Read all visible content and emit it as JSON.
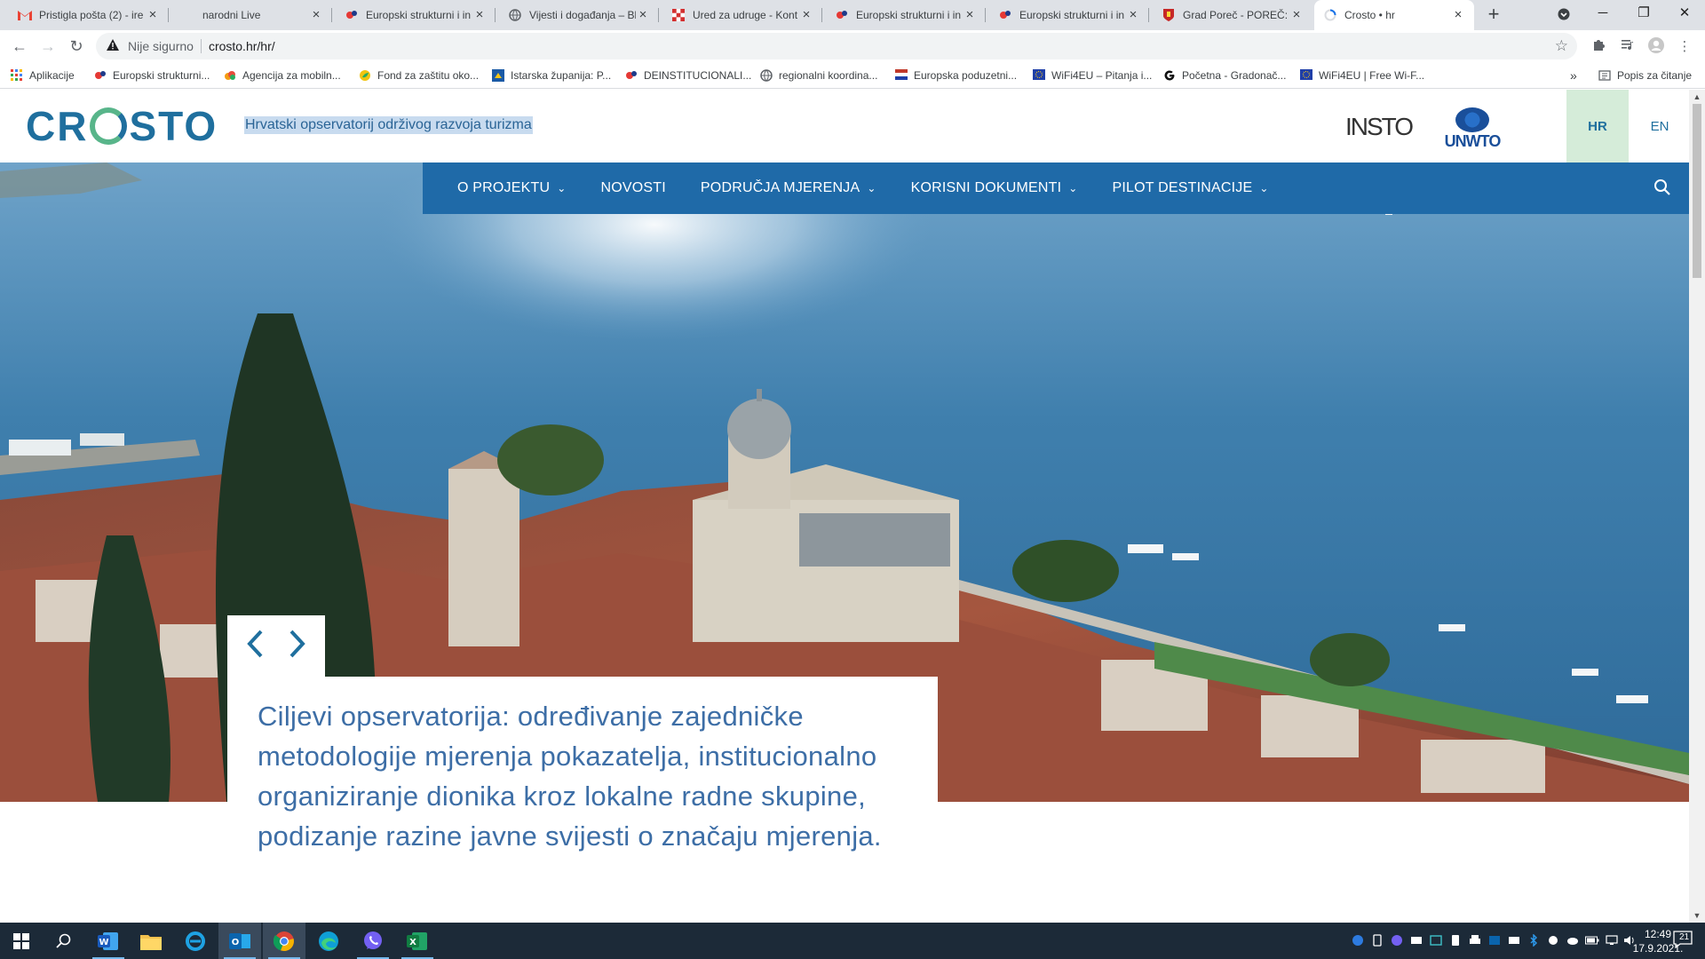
{
  "browser": {
    "tabs": [
      {
        "title": "Pristigla pošta (2) - ire",
        "icon": "gmail-icon"
      },
      {
        "title": "narodni Live",
        "icon": "none"
      },
      {
        "title": "Europski strukturni i in",
        "icon": "eu-funds-icon"
      },
      {
        "title": "Vijesti i događanja – Bl",
        "icon": "globe-icon"
      },
      {
        "title": "Ured za udruge - Kont",
        "icon": "croatia-checker-icon"
      },
      {
        "title": "Europski strukturni i in",
        "icon": "eu-funds-icon"
      },
      {
        "title": "Europski strukturni i in",
        "icon": "eu-funds-icon"
      },
      {
        "title": "Grad Poreč - POREČ: n",
        "icon": "porec-crest-icon"
      },
      {
        "title": "Crosto • hr",
        "icon": "loading-icon",
        "active": true
      }
    ],
    "security_label": "Nije sigurno",
    "url": "crosto.hr/hr/",
    "bookmarks": [
      {
        "label": "Aplikacije",
        "icon": "apps-grid-icon",
        "color": "#e94235"
      },
      {
        "label": "Europski strukturni...",
        "icon": "eu-funds-icon",
        "color": "#e53935"
      },
      {
        "label": "Agencija za mobiln...",
        "icon": "cloud-icon",
        "color": "#f39c12"
      },
      {
        "label": "Fond za zaštitu oko...",
        "icon": "leaf-icon",
        "color": "#f1c40f"
      },
      {
        "label": "Istarska županija: P...",
        "icon": "istria-icon",
        "color": "#1a5aa6"
      },
      {
        "label": "DEINSTITUCIONALI...",
        "icon": "eu-funds-icon",
        "color": "#e53935"
      },
      {
        "label": "regionalni koordina...",
        "icon": "globe-icon",
        "color": "#5f6368"
      },
      {
        "label": "Europska poduzetni...",
        "icon": "flag-icon",
        "color": "#c0392b"
      },
      {
        "label": "WiFi4EU – Pitanja i...",
        "icon": "eu-flag-icon",
        "color": "#1f3fa8"
      },
      {
        "label": "Početna - Gradonač...",
        "icon": "g-logo-icon",
        "color": "#111111"
      },
      {
        "label": "WiFi4EU | Free Wi-F...",
        "icon": "eu-flag-icon",
        "color": "#1f3fa8"
      }
    ],
    "reading_list": "Popis za čitanje"
  },
  "site": {
    "logo_text": "CROSTO",
    "tagline": "Hrvatski opservatorij održivog razvoja turizma",
    "partner1": "INSTO",
    "partner2": "UNWTO",
    "lang_hr": "HR",
    "lang_en": "EN",
    "nav": [
      {
        "label": "O PROJEKTU",
        "dropdown": true
      },
      {
        "label": "NOVOSTI",
        "dropdown": false
      },
      {
        "label": "PODRUČJA MJERENJA",
        "dropdown": true
      },
      {
        "label": "KORISNI DOKUMENTI",
        "dropdown": true
      },
      {
        "label": "PILOT DESTINACIJE",
        "dropdown": true
      }
    ],
    "slide_caption": "Ciljevi opservatorija: određivanje zajedničke metodologije mjerenja pokazatelja, institucionalno organiziranje dionika kroz lokalne radne skupine, podizanje razine javne svijesti o značaju mjerenja.",
    "colors": {
      "brand_blue": "#1f6aa8",
      "caption_blue": "#3d6ea6",
      "lang_active_bg": "#d5ecd9"
    }
  },
  "taskbar": {
    "time": "12:49",
    "date": "17.9.2021.",
    "notifications": "21",
    "apps": [
      "windows-start-icon",
      "search-icon",
      "word-icon",
      "file-explorer-icon",
      "internet-explorer-icon",
      "outlook-icon",
      "chrome-icon",
      "edge-icon",
      "viber-icon",
      "excel-icon"
    ]
  }
}
